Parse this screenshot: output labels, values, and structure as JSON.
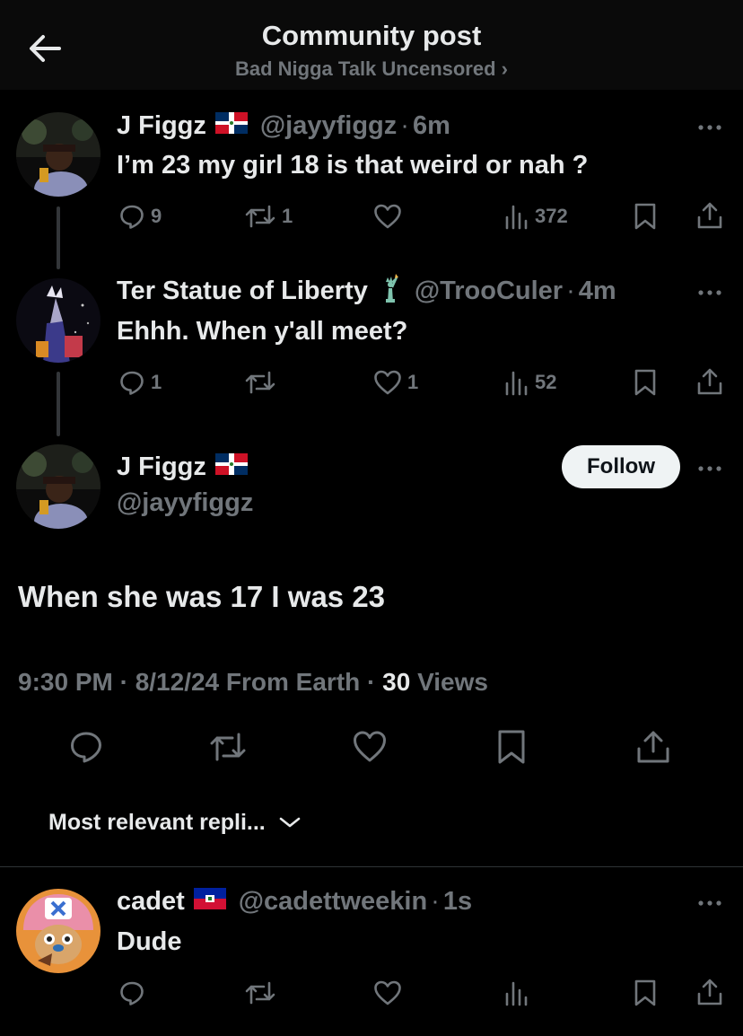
{
  "header": {
    "title": "Community post",
    "community": "Bad Nigga Talk Uncensored ›"
  },
  "tweets": [
    {
      "name": "J Figgz",
      "handle": "@jayyfiggz",
      "separator": "·",
      "time": "6m",
      "text": "I’m 23 my girl 18 is that weird or nah ?",
      "replies": "9",
      "retweets": "1",
      "likes": "",
      "views": "372",
      "flag": "dominican-republic-flag"
    },
    {
      "name": "Ter Statue of Liberty",
      "handle": "@TrooCuler",
      "separator": "·",
      "time": "4m",
      "text": "Ehhh. When y'all meet?",
      "replies": "1",
      "retweets": "",
      "likes": "1",
      "views": "52",
      "emoji": "statue-of-liberty-icon"
    }
  ],
  "main_tweet": {
    "name": "J Figgz",
    "handle": "@jayyfiggz",
    "follow_label": "Follow",
    "text": "When she was 17 I was 23",
    "meta_prefix": "9:30 PM · 8/12/24 From Earth · ",
    "views_count": "30",
    "views_label": " Views",
    "flag": "dominican-republic-flag"
  },
  "replies_sort": {
    "label": "Most relevant repli..."
  },
  "reply": {
    "name": "cadet",
    "handle": "@cadettweekin",
    "separator": "·",
    "time": "1s",
    "text": "Dude",
    "flag": "haiti-flag"
  },
  "colors": {
    "background": "#000000",
    "text": "#e7e9ea",
    "muted": "#71767b",
    "divider": "#2f3336"
  }
}
